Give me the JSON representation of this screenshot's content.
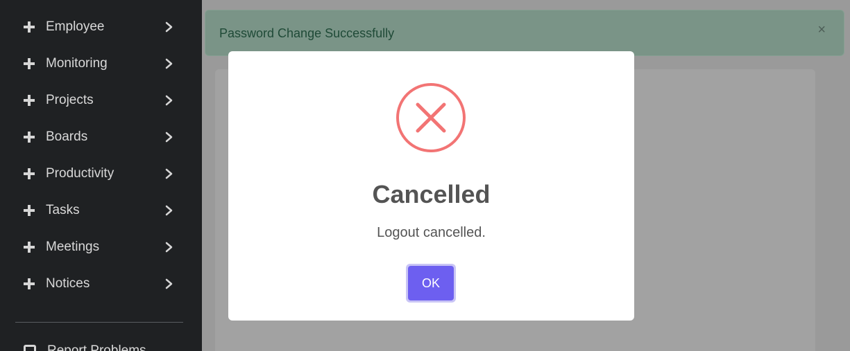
{
  "sidebar": {
    "items": [
      {
        "label": "Employee"
      },
      {
        "label": "Monitoring"
      },
      {
        "label": "Projects"
      },
      {
        "label": "Boards"
      },
      {
        "label": "Productivity"
      },
      {
        "label": "Tasks"
      },
      {
        "label": "Meetings"
      },
      {
        "label": "Notices"
      }
    ],
    "partial_label": "Report Problems",
    "item_icon": "plus-icon",
    "chevron_icon": "chevron-right-icon"
  },
  "alert": {
    "text": "Password Change Successfully",
    "close_label": "×"
  },
  "modal": {
    "icon": "error-x-icon",
    "title": "Cancelled",
    "message": "Logout cancelled.",
    "ok_label": "OK"
  },
  "colors": {
    "sidebar_bg": "#1f2123",
    "accent": "#6d5ff0",
    "error": "#f27474",
    "alert_bg": "#7a9487"
  }
}
